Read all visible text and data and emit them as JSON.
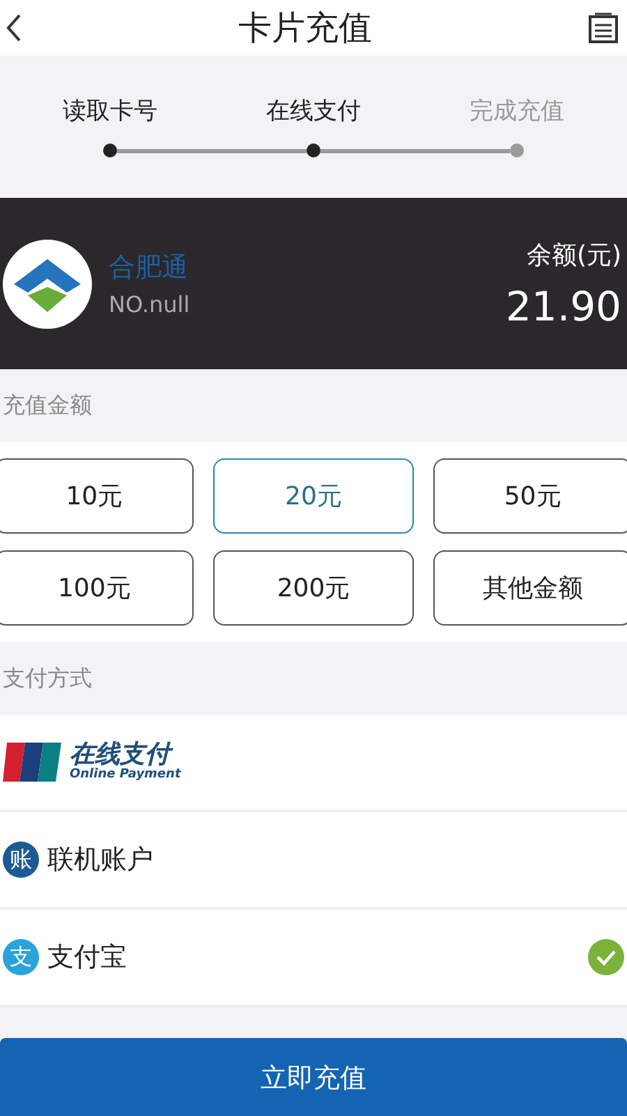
{
  "header": {
    "title": "卡片充值"
  },
  "steps": [
    {
      "label": "读取卡号",
      "done": true
    },
    {
      "label": "在线支付",
      "done": true
    },
    {
      "label": "完成充值",
      "done": false
    }
  ],
  "card": {
    "name": "合肥通",
    "number": "NO.null",
    "balance_label": "余额(元)",
    "balance": "21.90"
  },
  "amount_section": {
    "title": "充值金额"
  },
  "amounts": [
    {
      "label": "10元",
      "selected": false
    },
    {
      "label": "20元",
      "selected": true
    },
    {
      "label": "50元",
      "selected": false
    },
    {
      "label": "100元",
      "selected": false
    },
    {
      "label": "200元",
      "selected": false
    },
    {
      "label": "其他金额",
      "selected": false
    }
  ],
  "payment_section": {
    "title": "支付方式"
  },
  "payment_methods": [
    {
      "kind": "unionpay",
      "label": "在线支付",
      "sublabel": "Online Payment",
      "selected": false
    },
    {
      "kind": "account",
      "icon_char": "账",
      "label": "联机账户",
      "selected": false
    },
    {
      "kind": "alipay",
      "icon_char": "支",
      "label": "支付宝",
      "selected": true
    }
  ],
  "submit": {
    "label": "立即充值"
  }
}
